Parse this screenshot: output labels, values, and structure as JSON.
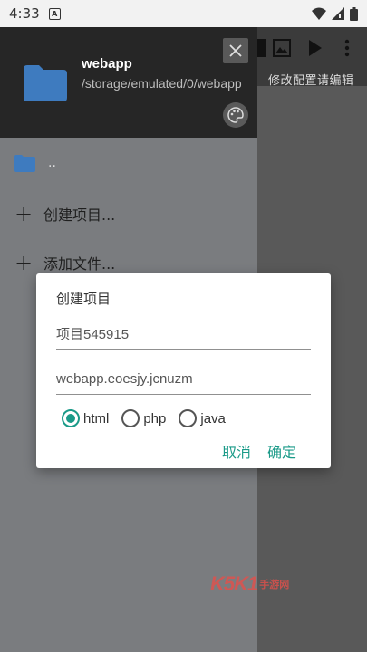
{
  "status_bar": {
    "time": "4:33",
    "notification_letter": "A"
  },
  "main": {
    "menu_text": "修改配置请编辑"
  },
  "drawer": {
    "header": {
      "title": "webapp",
      "path": "/storage/emulated/0/webapp"
    },
    "parent_dir_label": "..",
    "items": [
      {
        "label": "创建项目..."
      },
      {
        "label": "添加文件..."
      }
    ]
  },
  "dialog": {
    "title": "创建项目",
    "project_name_value": "项目545915",
    "package_value": "webapp.eoesjy.jcnuzm",
    "radio_options": [
      {
        "label": "html",
        "checked": true
      },
      {
        "label": "php",
        "checked": false
      },
      {
        "label": "java",
        "checked": false
      }
    ],
    "cancel_label": "取消",
    "ok_label": "确定"
  },
  "watermark": {
    "text": "手游网"
  },
  "colors": {
    "accent": "#1a9a88",
    "folder": "#3e7bbf",
    "drawer_bg": "#7a7c7f",
    "header_bg": "#262626"
  }
}
